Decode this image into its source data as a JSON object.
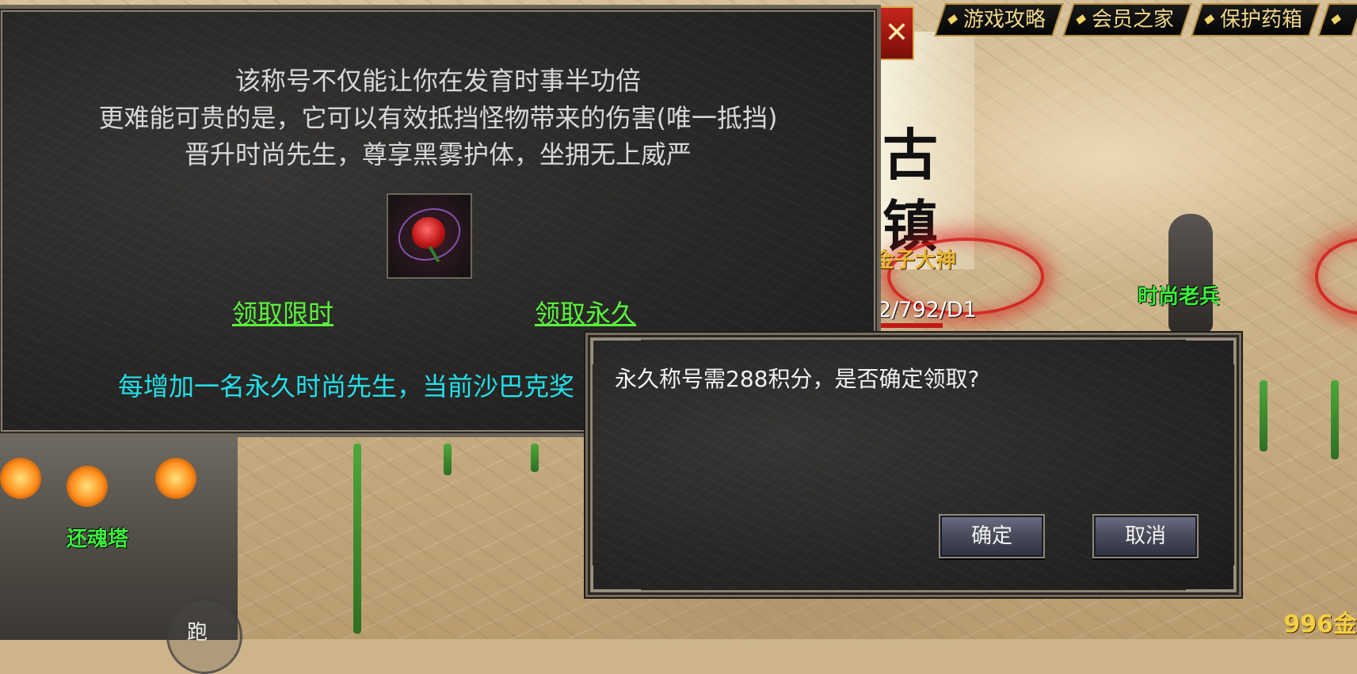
{
  "top_nav": {
    "items": [
      {
        "label": "游戏攻略"
      },
      {
        "label": "会员之家"
      },
      {
        "label": "保护药箱"
      }
    ]
  },
  "panel": {
    "description": [
      "该称号不仅能让你在发育时事半功倍",
      "更难能可贵的是，它可以有效抵挡怪物带来的伤害(唯一抵挡)",
      "晋升时尚先生，尊享黑雾护体，坐拥无上威严"
    ],
    "claim_timed_label": "领取限时",
    "claim_permanent_label": "领取永久",
    "notice": "每增加一名永久时尚先生，当前沙巴克奖"
  },
  "dialog": {
    "message": "永久称号需288积分，是否确定领取?",
    "confirm_label": "确定",
    "cancel_label": "取消"
  },
  "world": {
    "sign_glyphs": [
      "古",
      "镇"
    ],
    "sign_subtitle": "金子大神",
    "coordinates": "2/792/D1",
    "npc_name": "时尚老兵",
    "tower_name": "还魂塔",
    "run_button_label": "跑",
    "gold_amount": "996金"
  },
  "colors": {
    "link_green": "#58f43b",
    "notice_cyan": "#22e0e8",
    "npc_green": "#3cf03c",
    "nav_gold": "#f0d88a",
    "close_red": "#c4261c"
  }
}
